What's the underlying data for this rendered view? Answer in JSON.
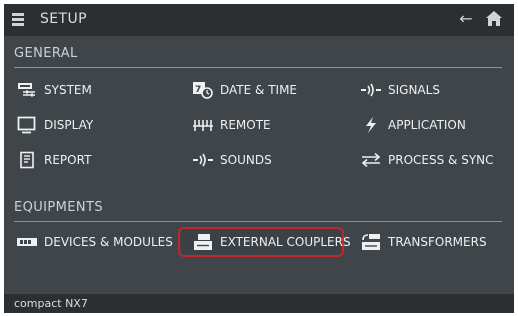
{
  "header": {
    "title": "SETUP"
  },
  "sections": {
    "general": {
      "label": "GENERAL",
      "items": [
        "SYSTEM",
        "DATE & TIME",
        "SIGNALS",
        "DISPLAY",
        "REMOTE",
        "APPLICATION",
        "REPORT",
        "SOUNDS",
        "PROCESS & SYNC"
      ]
    },
    "equipments": {
      "label": "EQUIPMENTS",
      "items": [
        "DEVICES & MODULES",
        "EXTERNAL COUPLERS",
        "TRANSFORMERS"
      ]
    }
  },
  "footer": {
    "device_name": "compact NX7"
  },
  "icons": {
    "menu": "hamburger-icon",
    "back": "back-arrow-icon",
    "home": "home-icon"
  },
  "colors": {
    "highlight_border": "#c3262b"
  }
}
